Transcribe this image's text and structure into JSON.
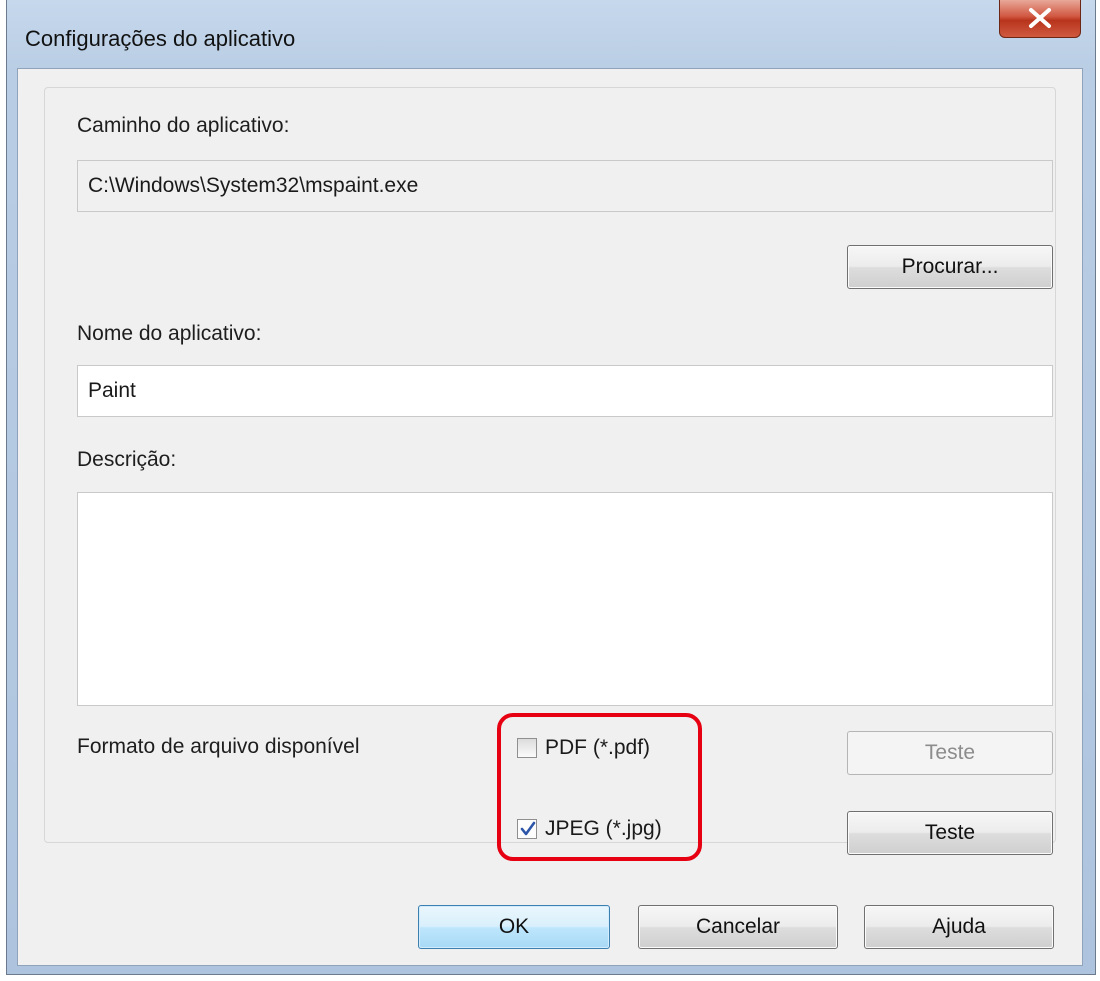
{
  "window": {
    "title": "Configurações do aplicativo"
  },
  "app_path": {
    "label": "Caminho do aplicativo:",
    "value": "C:\\Windows\\System32\\mspaint.exe"
  },
  "browse_button": "Procurar...",
  "app_name": {
    "label": "Nome do aplicativo:",
    "value": "Paint"
  },
  "description": {
    "label": "Descrição:",
    "value": ""
  },
  "formats": {
    "label": "Formato de arquivo disponível",
    "pdf": {
      "label": "PDF (*.pdf)",
      "checked": false,
      "test_label": "Teste",
      "test_enabled": false
    },
    "jpeg": {
      "label": "JPEG (*.jpg)",
      "checked": true,
      "test_label": "Teste",
      "test_enabled": true
    }
  },
  "footer": {
    "ok": "OK",
    "cancel": "Cancelar",
    "help": "Ajuda"
  },
  "colors": {
    "highlight": "#e60012",
    "close": "#c8452c",
    "titlebar": "#b9cde4"
  }
}
